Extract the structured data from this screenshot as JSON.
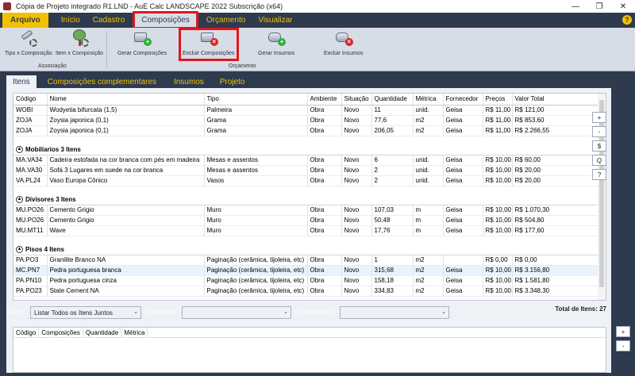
{
  "window": {
    "title": "Cópia de Projeto integrado R1.LND - AuE Calc LANDSCAPE 2022 Subscrição (x64)",
    "minimize": "—",
    "maximize": "❐",
    "close": "✕"
  },
  "ribbon_tabs": [
    "Arquivo",
    "Início",
    "Cadastro",
    "Composições",
    "Orçamento",
    "Visualizar"
  ],
  "help": "?",
  "ribbon": {
    "buttons": [
      {
        "label": "Tipo x Composição"
      },
      {
        "label": "Item x Composição"
      },
      {
        "label": "Gerar Composições"
      },
      {
        "label": "Excluir Composições"
      },
      {
        "label": "Gerar Insumos"
      },
      {
        "label": "Excluir Insumos"
      }
    ],
    "groups": [
      "Associação",
      "Orçamento"
    ]
  },
  "content_tabs": [
    "Itens",
    "Composições complementares",
    "Insumos",
    "Projeto"
  ],
  "table": {
    "columns": [
      "Código",
      "Nome",
      "Tipo",
      "Ambiente",
      "Situação",
      "Quantidade",
      "Métrica",
      "Fornecedor",
      "Preços",
      "Valor Total"
    ],
    "top_rows": [
      [
        "WOBI",
        "Wodyetia bifurcata (1,5)",
        "Palmeira",
        "Obra",
        "Novo",
        "11",
        "unid.",
        "Geisa",
        "R$ 11,00",
        "R$ 121,00"
      ],
      [
        "ZOJA",
        "Zoysia japonica (0,1)",
        "Grama",
        "Obra",
        "Novo",
        "77,6",
        "m2",
        "Geisa",
        "R$ 11,00",
        "R$ 853,60"
      ],
      [
        "ZOJA",
        "Zoysia japonica (0,1)",
        "Grama",
        "Obra",
        "Novo",
        "206,05",
        "m2",
        "Geisa",
        "R$ 11,00",
        "R$ 2.266,55"
      ]
    ],
    "groups": [
      {
        "title": "Mobiliarios  3 Itens",
        "rows": [
          [
            "MA.VA34",
            "Cadeira estofada na cor branca com pés em madeira",
            "Mesas e assentos",
            "Obra",
            "Novo",
            "6",
            "unid.",
            "Geisa",
            "R$ 10,00",
            "R$ 60,00"
          ],
          [
            "MA.VA30",
            "Sofá 3 Lugares em suede na cor branca",
            "Mesas e assentos",
            "Obra",
            "Novo",
            "2",
            "unid.",
            "Geisa",
            "R$ 10,00",
            "R$ 20,00"
          ],
          [
            "VA.PL24",
            "Vaso Europa Cônico",
            "Vasos",
            "Obra",
            "Novo",
            "2",
            "unid.",
            "Geisa",
            "R$ 10,00",
            "R$ 20,00"
          ]
        ]
      },
      {
        "title": "Divisores  3 Itens",
        "rows": [
          [
            "MU.PO26",
            "Cemento Grigio",
            "Muro",
            "Obra",
            "Novo",
            "107,03",
            "m",
            "Geisa",
            "R$ 10,00",
            "R$ 1.070,30"
          ],
          [
            "MU.PO26",
            "Cemento Grigio",
            "Muro",
            "Obra",
            "Novo",
            "50,48",
            "m",
            "Geisa",
            "R$ 10,00",
            "R$ 504,80"
          ],
          [
            "MU.MT11",
            "Wave",
            "Muro",
            "Obra",
            "Novo",
            "17,76",
            "m",
            "Geisa",
            "R$ 10,00",
            "R$ 177,60"
          ]
        ]
      },
      {
        "title": "Pisos  4 Itens",
        "rows": [
          [
            "PA.PO3",
            "Granilite Branco NA",
            "Paginação (cerâmica, tijoleira, etc)",
            "Obra",
            "Novo",
            "1",
            "m2",
            "",
            "R$ 0,00",
            "R$ 0,00"
          ],
          [
            "MC.PN7",
            "Pedra portuguesa branca",
            "Paginação (cerâmica, tijoleira, etc)",
            "Obra",
            "Novo",
            "315,68",
            "m2",
            "Geisa",
            "R$ 10,00",
            "R$ 3.156,80"
          ],
          [
            "PA.PN10",
            "Pedra portuguesa cinza",
            "Paginação (cerâmica, tijoleira, etc)",
            "Obra",
            "Novo",
            "158,18",
            "m2",
            "Geisa",
            "R$ 10,00",
            "R$ 1.581,80"
          ],
          [
            "PA.PO23",
            "State Cement NA",
            "Paginação (cerâmica, tijoleira, etc)",
            "Obra",
            "Novo",
            "334,83",
            "m2",
            "Geisa",
            "R$ 10,00",
            "R$ 3.348,30"
          ]
        ]
      }
    ]
  },
  "side_buttons": [
    "+",
    "-",
    "$",
    "Q",
    "?"
  ],
  "filters": {
    "listar_label": "Listar:",
    "listar_value": "Listar Todos os Itens Juntos",
    "ambiente_label": "Ambiente:",
    "ambiente_value": "",
    "fornecedor_label": "Fornecedor:",
    "fornecedor_value": "",
    "total": "Total de Itens: 27"
  },
  "comp_table": {
    "columns": [
      "Código",
      "Composições",
      "Quantidade",
      "Métrica"
    ]
  },
  "side_buttons2": [
    "+",
    "-"
  ],
  "colors": {
    "accent": "#f2c200",
    "frame": "#2e3a4e",
    "highlight": "#e0161c"
  }
}
